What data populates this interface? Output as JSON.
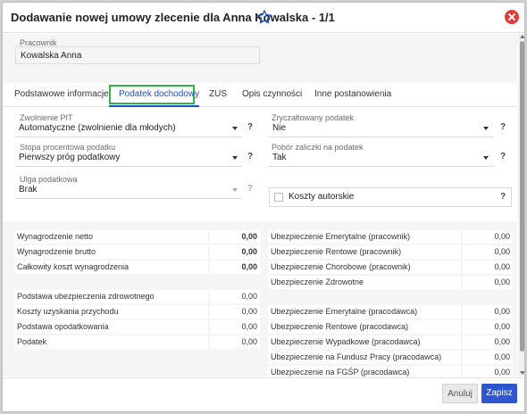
{
  "dialog": {
    "title": "Dodawanie nowej umowy zlecenie dla Anna Kowalska - 1/1"
  },
  "employee": {
    "label": "Pracownik",
    "value": "Kowalska Anna"
  },
  "tabs": [
    {
      "label": "Podstawowe informacje"
    },
    {
      "label": "Podatek dochodowy"
    },
    {
      "label": "ZUS"
    },
    {
      "label": "Opis czynności"
    },
    {
      "label": "Inne postanowienia"
    }
  ],
  "form": {
    "zwolnienie": {
      "label": "Zwolnienie PIT",
      "value": "Automatyczne (zwolnienie dla młodych)"
    },
    "zryczaltowany": {
      "label": "Zryczałtowany podatek",
      "value": "Nie"
    },
    "stopa": {
      "label": "Stopa procentowa podatku",
      "value": "Pierwszy próg podatkowy"
    },
    "pobor": {
      "label": "Pobór zaliczki na podatek",
      "value": "Tak"
    },
    "ulga": {
      "label": "Ulga podatkowa",
      "value": "Brak"
    },
    "koszty_autorskie": {
      "label": "Koszty autorskie"
    },
    "help": "?"
  },
  "summary_left_top": [
    {
      "label": "Wynagrodzenie netto",
      "value": "0,00"
    },
    {
      "label": "Wynagrodzenie brutto",
      "value": "0,00"
    },
    {
      "label": "Całkowity koszt wynagrodzenia",
      "value": "0,00"
    }
  ],
  "summary_left_bottom": [
    {
      "label": "Podstawa ubezpieczenia zdrowotnego",
      "value": "0,00"
    },
    {
      "label": "Koszty uzyskania przychodu",
      "value": "0,00"
    },
    {
      "label": "Podstawa opodatkowania",
      "value": "0,00"
    },
    {
      "label": "Podatek",
      "value": "0,00"
    }
  ],
  "summary_right_top": [
    {
      "label": "Ubezpieczenie Emerytalne (pracownik)",
      "value": "0,00"
    },
    {
      "label": "Ubezpieczenie Rentowe (pracownik)",
      "value": "0,00"
    },
    {
      "label": "Ubezpieczenie Chorobowe (pracownik)",
      "value": "0,00"
    },
    {
      "label": "Ubezpieczenie Zdrowotne",
      "value": "0,00"
    }
  ],
  "summary_right_bottom": [
    {
      "label": "Ubezpieczenie Emerytalne (pracodawca)",
      "value": "0,00"
    },
    {
      "label": "Ubezpieczenie Rentowe (pracodawca)",
      "value": "0,00"
    },
    {
      "label": "Ubezpieczenie Wypadkowe (pracodawca)",
      "value": "0,00"
    },
    {
      "label": "Ubezpieczenie na Fundusz Pracy (pracodawca)",
      "value": "0,00"
    },
    {
      "label": "Ubezpieczenie na FGŚP (pracodawca)",
      "value": "0,00"
    }
  ],
  "footer": {
    "cancel": "Anuluj",
    "save": "Zapisz"
  },
  "colors": {
    "primary": "#2d57cf",
    "active_tab_outline": "#2fb44b",
    "close": "#e53935"
  }
}
